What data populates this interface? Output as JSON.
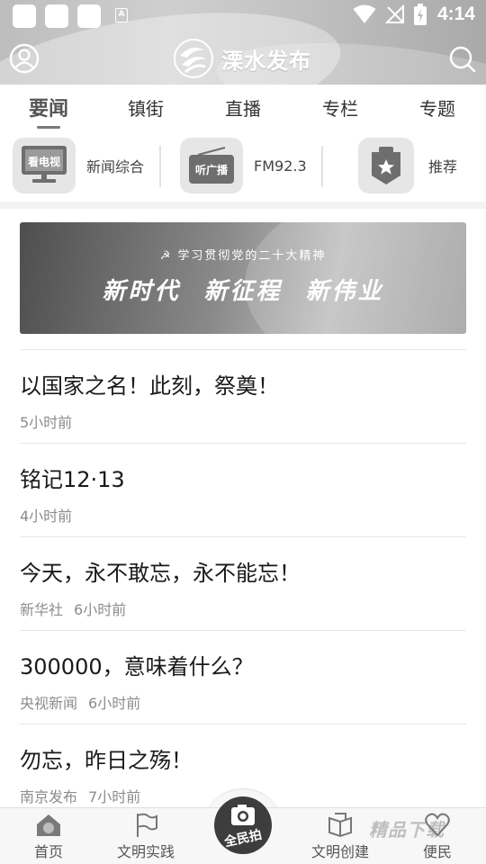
{
  "status_bar": {
    "time": "4:14"
  },
  "header": {
    "logo_text": "溧水发布"
  },
  "tabs": [
    {
      "label": "要闻",
      "active": true
    },
    {
      "label": "镇街"
    },
    {
      "label": "直播"
    },
    {
      "label": "专栏"
    },
    {
      "label": "专题"
    }
  ],
  "channels": [
    {
      "badge": "看电视",
      "label": "新闻综合",
      "icon": "tv-icon"
    },
    {
      "badge": "听广播",
      "label": "FM92.3",
      "icon": "radio-icon"
    },
    {
      "badge": "",
      "label": "推荐",
      "icon": "star-badge-icon"
    }
  ],
  "promo": {
    "top_line": "学习贯彻党的二十大精神",
    "main_line": "新时代 新征程 新伟业"
  },
  "news": [
    {
      "title": "以国家之名！此刻，祭奠！",
      "source": "",
      "time": "5小时前"
    },
    {
      "title": "铭记12·13",
      "source": "",
      "time": "4小时前"
    },
    {
      "title": "今天，永不敢忘，永不能忘！",
      "source": "新华社",
      "time": "6小时前"
    },
    {
      "title": "300000，意味着什么？",
      "source": "央视新闻",
      "time": "6小时前"
    },
    {
      "title": "勿忘，昨日之殇！",
      "source": "南京发布",
      "time": "7小时前"
    }
  ],
  "bottom_nav": [
    {
      "label": "首页",
      "icon": "home-icon"
    },
    {
      "label": "文明实践",
      "icon": "flag-icon"
    },
    {
      "label": "全民拍",
      "icon": "camera-icon"
    },
    {
      "label": "文明创建",
      "icon": "book-icon"
    },
    {
      "label": "便民",
      "icon": "heart-icon"
    }
  ],
  "watermark": "精品下载"
}
